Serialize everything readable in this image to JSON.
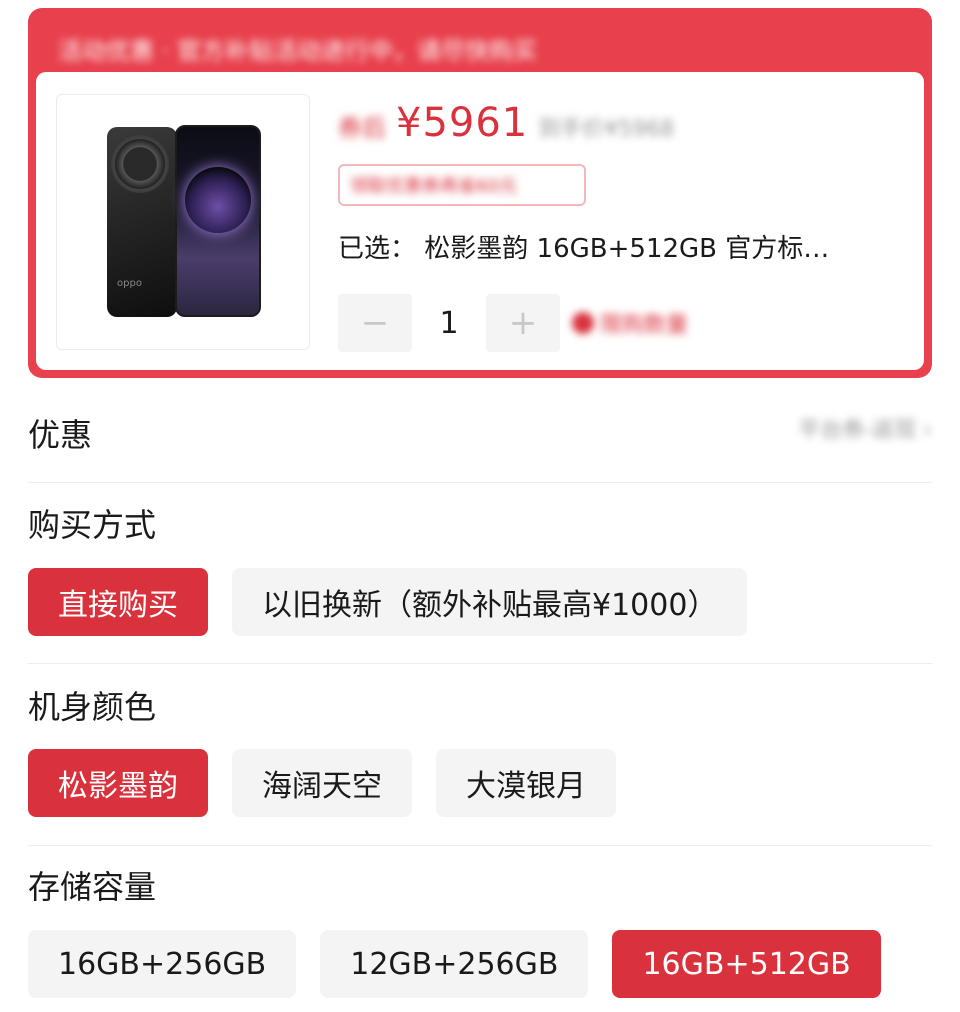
{
  "product_card": {
    "banner_text": "活动优惠 · 官方补贴活动进行中，请尽快购买",
    "price_label": "券后",
    "price": "¥5961",
    "original_price": "到手价¥5968",
    "coupon_text": "领取优惠券再省60元",
    "selected_label": "已选：",
    "selected_value": "松影墨韵 16GB+512GB 官方标…",
    "quantity": "1",
    "minus_symbol": "−",
    "plus_symbol": "+",
    "limit_note": "限购数量",
    "phone_brand_text": "oppo",
    "colors": {
      "accent": "#e8404c",
      "price": "#d9323d",
      "chip_bg": "#f4f4f4"
    }
  },
  "promo": {
    "title": "优惠",
    "right_text": "平台券-返现 ›"
  },
  "purchase_method": {
    "title": "购买方式",
    "options": [
      {
        "label": "直接购买",
        "active": true
      },
      {
        "label": "以旧换新（额外补贴最高¥1000）",
        "active": false
      }
    ]
  },
  "color": {
    "title": "机身颜色",
    "options": [
      {
        "label": "松影墨韵",
        "active": true
      },
      {
        "label": "海阔天空",
        "active": false
      },
      {
        "label": "大漠银月",
        "active": false
      }
    ]
  },
  "storage": {
    "title": "存储容量",
    "options": [
      {
        "label": "16GB+256GB",
        "active": false
      },
      {
        "label": "12GB+256GB",
        "active": false
      },
      {
        "label": "16GB+512GB",
        "active": true
      }
    ]
  }
}
